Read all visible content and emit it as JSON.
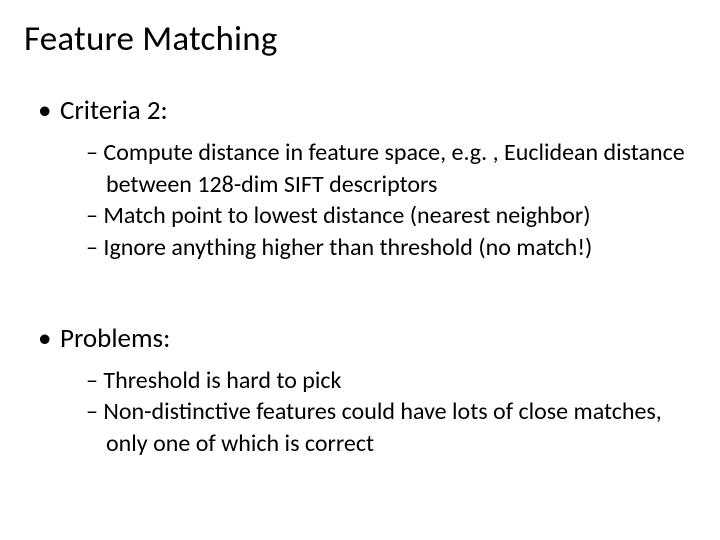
{
  "title": "Feature Matching",
  "sections": [
    {
      "heading": "Criteria 2:",
      "items": [
        "Compute distance in feature space, e.g. , Euclidean distance between 128-dim SIFT descriptors",
        "Match point to lowest distance (nearest neighbor)",
        "Ignore anything higher than threshold (no match!)"
      ]
    },
    {
      "heading": "Problems:",
      "items": [
        "Threshold is hard to pick",
        "Non-distinctive features could have lots of close matches, only one of which is correct"
      ]
    }
  ],
  "bullets": {
    "level1": "•",
    "level2": "–"
  }
}
